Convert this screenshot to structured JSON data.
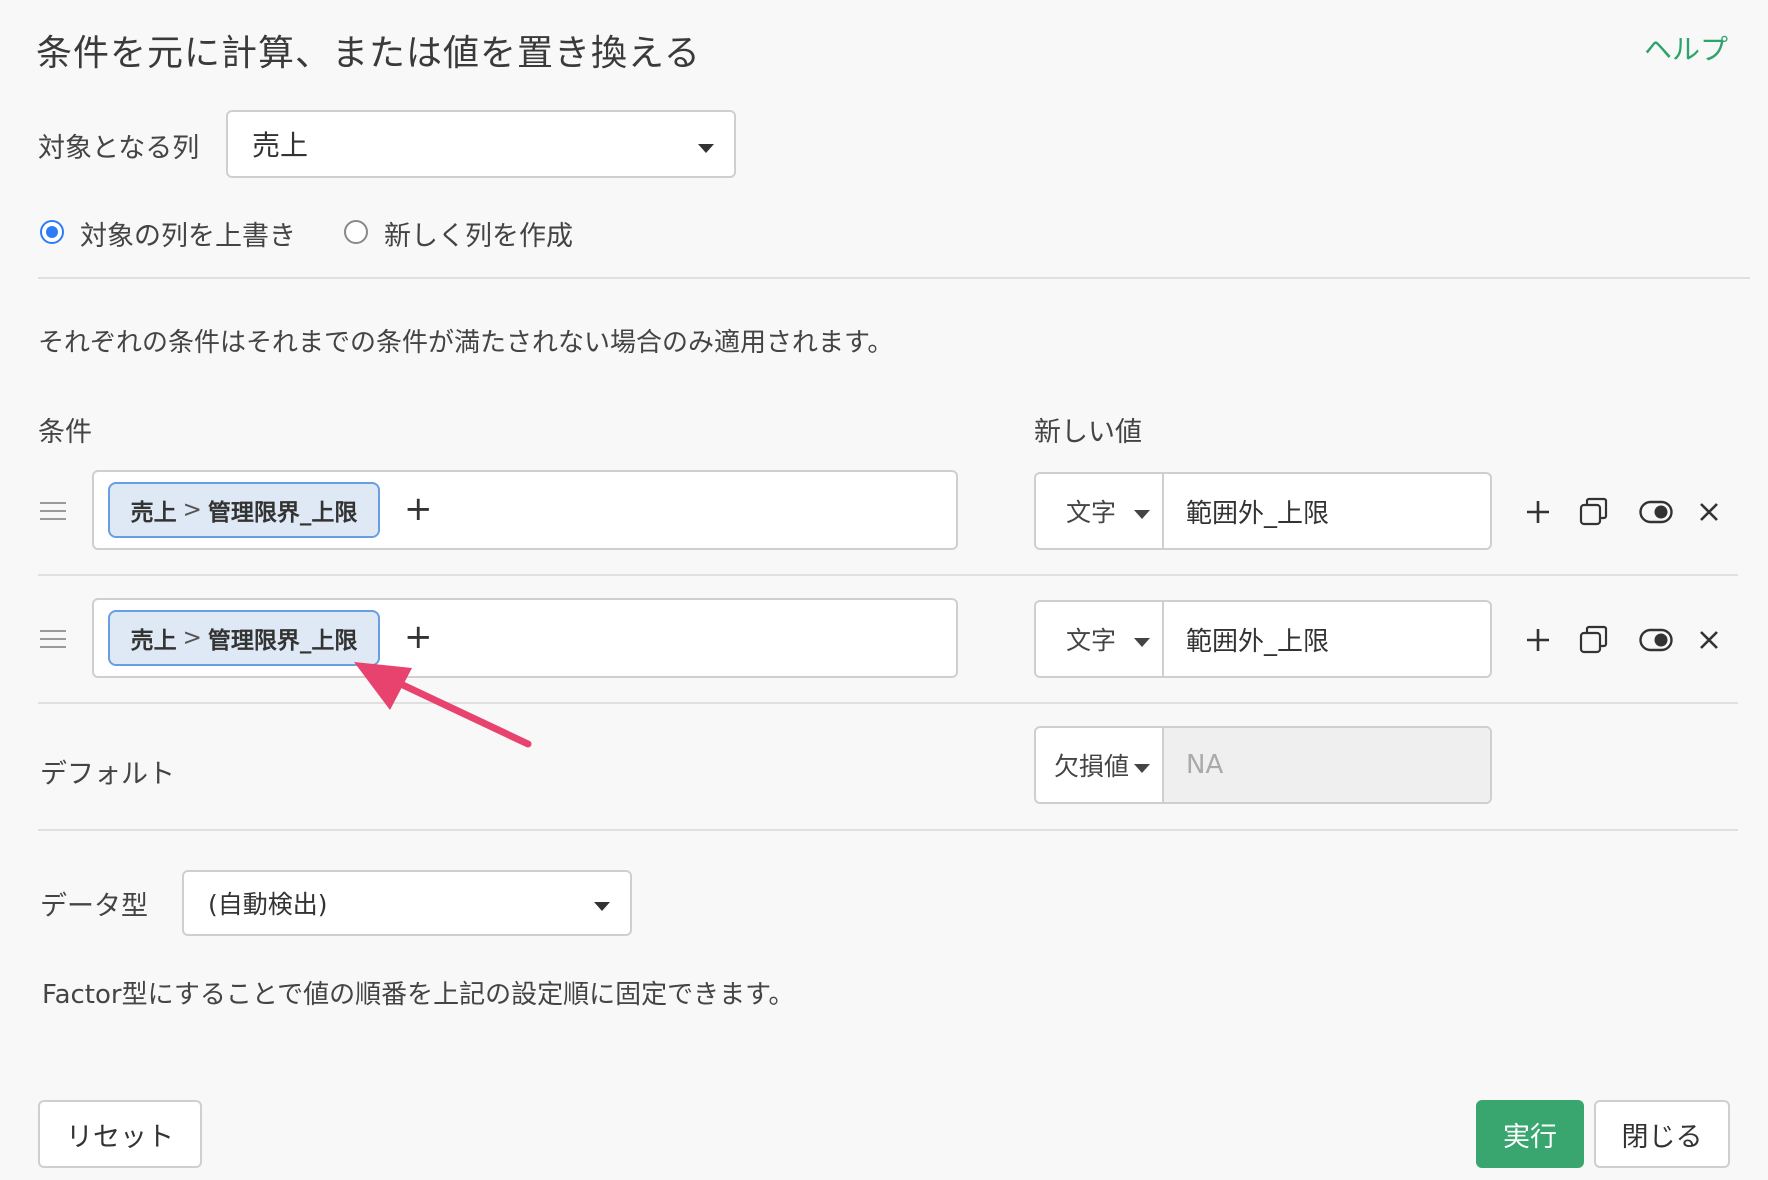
{
  "dialog": {
    "title": "条件を元に計算、または値を置き換える",
    "help_label": "ヘルプ"
  },
  "target_column": {
    "label": "対象となる列",
    "selected": "売上"
  },
  "output_mode": {
    "options": [
      {
        "label": "対象の列を上書き",
        "selected": true
      },
      {
        "label": "新しく列を作成",
        "selected": false
      }
    ]
  },
  "description": "それぞれの条件はそれまでの条件が満たされない場合のみ適用されます。",
  "headers": {
    "condition": "条件",
    "new_value": "新しい値"
  },
  "conditions": [
    {
      "chip_left": "売上",
      "chip_op": ">",
      "chip_right": "管理限界_上限",
      "value_type": "文字",
      "value": "範囲外_上限"
    },
    {
      "chip_left": "売上",
      "chip_op": ">",
      "chip_right": "管理限界_上限",
      "value_type": "文字",
      "value": "範囲外_上限"
    }
  ],
  "default": {
    "label": "デフォルト",
    "value_type": "欠損値",
    "value": "NA"
  },
  "data_type": {
    "label": "データ型",
    "selected": "(自動検出)"
  },
  "factor_note": "Factor型にすることで値の順番を上記の設定順に固定できます。",
  "footer": {
    "reset_label": "リセット",
    "run_label": "実行",
    "close_label": "閉じる"
  },
  "colors": {
    "accent_green": "#3aa66f",
    "chip_border": "#6a9ee3",
    "radio_blue": "#2d7cf6",
    "annotation_arrow": "#e8436e"
  }
}
